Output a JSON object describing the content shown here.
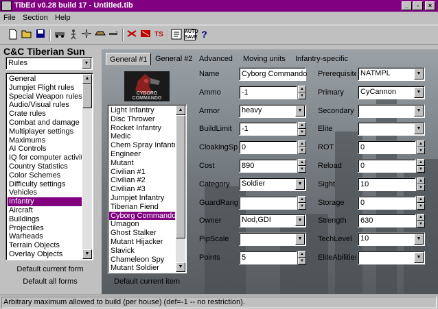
{
  "window": {
    "title": "TibEd v0.28 build 17 - Untitled.tib",
    "min": "_",
    "max": "▫",
    "close": "×"
  },
  "menu": [
    "File",
    "Section",
    "Help"
  ],
  "toolbar": {
    "icons": [
      "new-icon",
      "open-icon",
      "save-icon",
      "tool1-icon",
      "tool2-icon",
      "tool3-icon",
      "tool4-icon",
      "tool5-icon",
      "tool6-icon",
      "tool7-icon",
      "tool8-icon",
      "options-icon",
      "autosave-icon",
      "help-icon"
    ],
    "ts_label": "TS",
    "autosave_top": "AUTO",
    "autosave_bottom": "SAVE",
    "help": "?"
  },
  "left": {
    "title": "C&C Tiberian Sun",
    "combo_value": "Rules",
    "items": [
      "General",
      "Jumpjet Flight rules",
      "Special Weapon rules",
      "Audio/Visual rules",
      "Crate rules",
      "Combat and damage ru",
      "Multiplayer settings",
      "Maximums",
      "AI Controls",
      "IQ for computer activity",
      "Country Statistics",
      "Color Schemes",
      "Difficulty settings",
      "Vehicles",
      "Infantry",
      "Aircraft",
      "Buildings",
      "Projectiles",
      "Warheads",
      "Terrain Objects",
      "Overlay Objects"
    ],
    "selected_index": 14,
    "btn_default_current": "Default current form",
    "btn_default_all": "Default all forms"
  },
  "tabs": [
    "General #1",
    "General #2",
    "Advanced",
    "Moving units",
    "Infantry-specific"
  ],
  "unit_image_caption": "CYBORG COMMANDO",
  "unitlist": {
    "items": [
      "Light Infantry",
      "Disc Thrower",
      "Rocket Infantry",
      "Medic",
      "Chem Spray Infantry -",
      "Engineer",
      "Mutant",
      "Civilian #1",
      "Civilian #2",
      "Civilian #3",
      "Jumpjet Infantry",
      "Tiberian Fiend",
      "Cyborg Commando",
      "Umagon",
      "Ghost Stalker",
      "Mutant Hijacker",
      "Slavick",
      "Chameleon Spy",
      "Mutant Soldier"
    ],
    "selected_index": 12,
    "btn_default_current": "Default current item"
  },
  "fields_left": [
    {
      "label": "Name",
      "value": "Cyborg Commando",
      "kind": "text"
    },
    {
      "label": "Ammo",
      "value": "-1",
      "kind": "spin"
    },
    {
      "label": "Armor",
      "value": "heavy",
      "kind": "combo"
    },
    {
      "label": "BuildLimit",
      "value": "-1",
      "kind": "spin"
    },
    {
      "label": "CloakingSpe",
      "value": "0",
      "kind": "spin"
    },
    {
      "label": "Cost",
      "value": "890",
      "kind": "spin"
    },
    {
      "label": "Category",
      "value": "Soldier",
      "kind": "combo"
    },
    {
      "label": "GuardRang",
      "value": "",
      "kind": "spin"
    },
    {
      "label": "Owner",
      "value": "Nod,GDI",
      "kind": "combo"
    },
    {
      "label": "PipScale",
      "value": "",
      "kind": "combo"
    },
    {
      "label": "Points",
      "value": "5",
      "kind": "spin"
    }
  ],
  "fields_right": [
    {
      "label": "Prerequisite",
      "value": "NATMPL",
      "kind": "combo"
    },
    {
      "label": "Primary",
      "value": "CyCannon",
      "kind": "combo"
    },
    {
      "label": "Secondary",
      "value": "",
      "kind": "combo"
    },
    {
      "label": "Elite",
      "value": "",
      "kind": "combo"
    },
    {
      "label": "ROT",
      "value": "0",
      "kind": "spin"
    },
    {
      "label": "Reload",
      "value": "0",
      "kind": "spin"
    },
    {
      "label": "Sight",
      "value": "10",
      "kind": "spin"
    },
    {
      "label": "Storage",
      "value": "0",
      "kind": "spin"
    },
    {
      "label": "Strength",
      "value": "630",
      "kind": "spin"
    },
    {
      "label": "TechLevel",
      "value": "10",
      "kind": "combo"
    },
    {
      "label": "EliteAbilities",
      "value": "",
      "kind": "combo"
    }
  ],
  "status": "Arbitrary maximum allowed to build (per house) (def=-1 -- no restriction).",
  "colors": {
    "titlebar": "#800080",
    "selection": "#800080",
    "face": "#c0c0c0"
  }
}
